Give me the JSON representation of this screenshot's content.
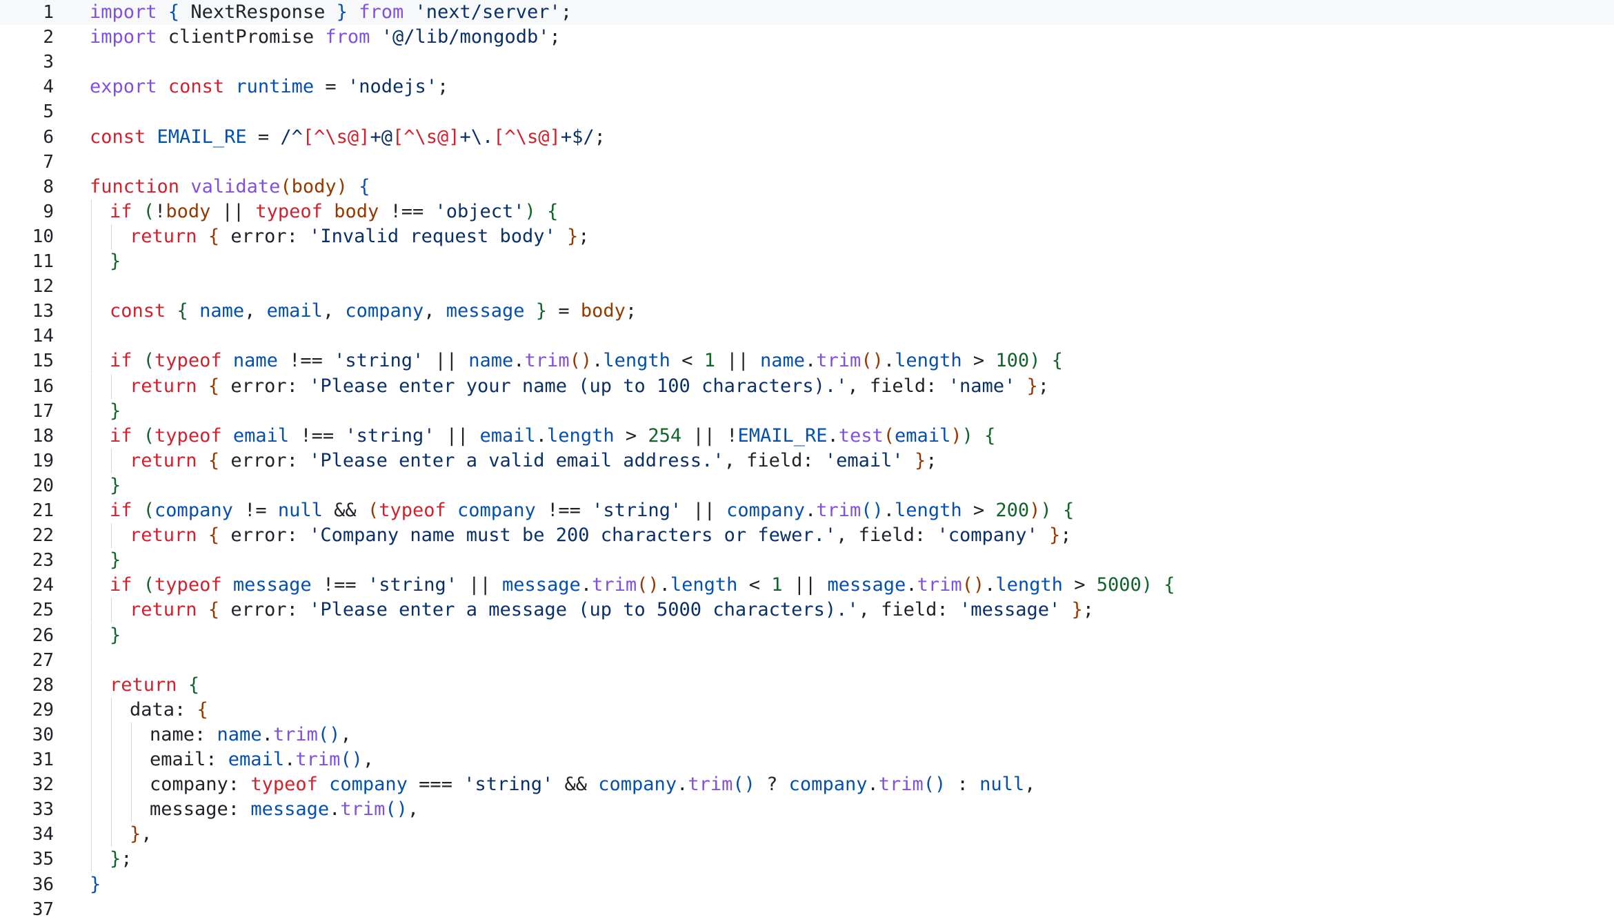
{
  "colors": {
    "keyword": "#cf222e",
    "keyword2": "#8250df",
    "fn": "#8250df",
    "ident": "#0550ae",
    "prop": "#1f2328",
    "str": "#0a3069",
    "num": "#116329",
    "regex": "#0a3069",
    "regexClass": "#cf222e",
    "brace1": "#0550ae",
    "brace2": "#116329",
    "brace3": "#953800",
    "brace0": "#1f2328",
    "plain": "#1f2328",
    "param": "#953800",
    "builtin": "#0550ae"
  },
  "lines": [
    {
      "n": "1",
      "indent": 0,
      "tokens": [
        [
          "keyword2",
          "import"
        ],
        [
          "plain",
          " "
        ],
        [
          "brace1",
          "{"
        ],
        [
          "plain",
          " NextResponse "
        ],
        [
          "brace1",
          "}"
        ],
        [
          "plain",
          " "
        ],
        [
          "keyword2",
          "from"
        ],
        [
          "plain",
          " "
        ],
        [
          "str",
          "'next/server'"
        ],
        [
          "plain",
          ";"
        ]
      ]
    },
    {
      "n": "2",
      "indent": 0,
      "tokens": [
        [
          "keyword2",
          "import"
        ],
        [
          "plain",
          " clientPromise "
        ],
        [
          "keyword2",
          "from"
        ],
        [
          "plain",
          " "
        ],
        [
          "str",
          "'@/lib/mongodb'"
        ],
        [
          "plain",
          ";"
        ]
      ]
    },
    {
      "n": "3",
      "indent": 0,
      "tokens": []
    },
    {
      "n": "4",
      "indent": 0,
      "tokens": [
        [
          "keyword2",
          "export"
        ],
        [
          "plain",
          " "
        ],
        [
          "keyword",
          "const"
        ],
        [
          "plain",
          " "
        ],
        [
          "ident",
          "runtime"
        ],
        [
          "plain",
          " = "
        ],
        [
          "str",
          "'nodejs'"
        ],
        [
          "plain",
          ";"
        ]
      ]
    },
    {
      "n": "5",
      "indent": 0,
      "tokens": []
    },
    {
      "n": "6",
      "indent": 0,
      "tokens": [
        [
          "keyword",
          "const"
        ],
        [
          "plain",
          " "
        ],
        [
          "ident",
          "EMAIL_RE"
        ],
        [
          "plain",
          " = "
        ],
        [
          "regex",
          "/^"
        ],
        [
          "regexClass",
          "[^\\s@]"
        ],
        [
          "regex",
          "+@"
        ],
        [
          "regexClass",
          "[^\\s@]"
        ],
        [
          "regex",
          "+\\."
        ],
        [
          "regexClass",
          "[^\\s@]"
        ],
        [
          "regex",
          "+$/"
        ],
        [
          "plain",
          ";"
        ]
      ]
    },
    {
      "n": "7",
      "indent": 0,
      "tokens": []
    },
    {
      "n": "8",
      "indent": 0,
      "tokens": [
        [
          "keyword",
          "function"
        ],
        [
          "plain",
          " "
        ],
        [
          "fn",
          "validate"
        ],
        [
          "brace3",
          "("
        ],
        [
          "param",
          "body"
        ],
        [
          "brace3",
          ")"
        ],
        [
          "plain",
          " "
        ],
        [
          "brace1",
          "{"
        ]
      ]
    },
    {
      "n": "9",
      "indent": 1,
      "tokens": [
        [
          "keyword",
          "if"
        ],
        [
          "plain",
          " "
        ],
        [
          "brace2",
          "("
        ],
        [
          "plain",
          "!"
        ],
        [
          "param",
          "body"
        ],
        [
          "plain",
          " || "
        ],
        [
          "keyword",
          "typeof"
        ],
        [
          "plain",
          " "
        ],
        [
          "param",
          "body"
        ],
        [
          "plain",
          " !== "
        ],
        [
          "str",
          "'object'"
        ],
        [
          "brace2",
          ")"
        ],
        [
          "plain",
          " "
        ],
        [
          "brace2",
          "{"
        ]
      ]
    },
    {
      "n": "10",
      "indent": 2,
      "tokens": [
        [
          "keyword",
          "return"
        ],
        [
          "plain",
          " "
        ],
        [
          "brace3",
          "{"
        ],
        [
          "plain",
          " error: "
        ],
        [
          "str",
          "'Invalid request body'"
        ],
        [
          "plain",
          " "
        ],
        [
          "brace3",
          "}"
        ],
        [
          "plain",
          ";"
        ]
      ]
    },
    {
      "n": "11",
      "indent": 1,
      "tokens": [
        [
          "brace2",
          "}"
        ]
      ]
    },
    {
      "n": "12",
      "indent": 1,
      "tokens": []
    },
    {
      "n": "13",
      "indent": 1,
      "tokens": [
        [
          "keyword",
          "const"
        ],
        [
          "plain",
          " "
        ],
        [
          "brace2",
          "{"
        ],
        [
          "plain",
          " "
        ],
        [
          "ident",
          "name"
        ],
        [
          "plain",
          ", "
        ],
        [
          "ident",
          "email"
        ],
        [
          "plain",
          ", "
        ],
        [
          "ident",
          "company"
        ],
        [
          "plain",
          ", "
        ],
        [
          "ident",
          "message"
        ],
        [
          "plain",
          " "
        ],
        [
          "brace2",
          "}"
        ],
        [
          "plain",
          " = "
        ],
        [
          "param",
          "body"
        ],
        [
          "plain",
          ";"
        ]
      ]
    },
    {
      "n": "14",
      "indent": 1,
      "tokens": []
    },
    {
      "n": "15",
      "indent": 1,
      "tokens": [
        [
          "keyword",
          "if"
        ],
        [
          "plain",
          " "
        ],
        [
          "brace2",
          "("
        ],
        [
          "keyword",
          "typeof"
        ],
        [
          "plain",
          " "
        ],
        [
          "ident",
          "name"
        ],
        [
          "plain",
          " !== "
        ],
        [
          "str",
          "'string'"
        ],
        [
          "plain",
          " || "
        ],
        [
          "ident",
          "name"
        ],
        [
          "plain",
          "."
        ],
        [
          "fn",
          "trim"
        ],
        [
          "brace3",
          "()"
        ],
        [
          "plain",
          "."
        ],
        [
          "builtin",
          "length"
        ],
        [
          "plain",
          " < "
        ],
        [
          "num",
          "1"
        ],
        [
          "plain",
          " || "
        ],
        [
          "ident",
          "name"
        ],
        [
          "plain",
          "."
        ],
        [
          "fn",
          "trim"
        ],
        [
          "brace3",
          "()"
        ],
        [
          "plain",
          "."
        ],
        [
          "builtin",
          "length"
        ],
        [
          "plain",
          " > "
        ],
        [
          "num",
          "100"
        ],
        [
          "brace2",
          ")"
        ],
        [
          "plain",
          " "
        ],
        [
          "brace2",
          "{"
        ]
      ]
    },
    {
      "n": "16",
      "indent": 2,
      "tokens": [
        [
          "keyword",
          "return"
        ],
        [
          "plain",
          " "
        ],
        [
          "brace3",
          "{"
        ],
        [
          "plain",
          " error: "
        ],
        [
          "str",
          "'Please enter your name (up to 100 characters).'"
        ],
        [
          "plain",
          ", field: "
        ],
        [
          "str",
          "'name'"
        ],
        [
          "plain",
          " "
        ],
        [
          "brace3",
          "}"
        ],
        [
          "plain",
          ";"
        ]
      ]
    },
    {
      "n": "17",
      "indent": 1,
      "tokens": [
        [
          "brace2",
          "}"
        ]
      ]
    },
    {
      "n": "18",
      "indent": 1,
      "tokens": [
        [
          "keyword",
          "if"
        ],
        [
          "plain",
          " "
        ],
        [
          "brace2",
          "("
        ],
        [
          "keyword",
          "typeof"
        ],
        [
          "plain",
          " "
        ],
        [
          "ident",
          "email"
        ],
        [
          "plain",
          " !== "
        ],
        [
          "str",
          "'string'"
        ],
        [
          "plain",
          " || "
        ],
        [
          "ident",
          "email"
        ],
        [
          "plain",
          "."
        ],
        [
          "builtin",
          "length"
        ],
        [
          "plain",
          " > "
        ],
        [
          "num",
          "254"
        ],
        [
          "plain",
          " || !"
        ],
        [
          "ident",
          "EMAIL_RE"
        ],
        [
          "plain",
          "."
        ],
        [
          "fn",
          "test"
        ],
        [
          "brace3",
          "("
        ],
        [
          "ident",
          "email"
        ],
        [
          "brace3",
          ")"
        ],
        [
          "brace2",
          ")"
        ],
        [
          "plain",
          " "
        ],
        [
          "brace2",
          "{"
        ]
      ]
    },
    {
      "n": "19",
      "indent": 2,
      "tokens": [
        [
          "keyword",
          "return"
        ],
        [
          "plain",
          " "
        ],
        [
          "brace3",
          "{"
        ],
        [
          "plain",
          " error: "
        ],
        [
          "str",
          "'Please enter a valid email address.'"
        ],
        [
          "plain",
          ", field: "
        ],
        [
          "str",
          "'email'"
        ],
        [
          "plain",
          " "
        ],
        [
          "brace3",
          "}"
        ],
        [
          "plain",
          ";"
        ]
      ]
    },
    {
      "n": "20",
      "indent": 1,
      "tokens": [
        [
          "brace2",
          "}"
        ]
      ]
    },
    {
      "n": "21",
      "indent": 1,
      "tokens": [
        [
          "keyword",
          "if"
        ],
        [
          "plain",
          " "
        ],
        [
          "brace2",
          "("
        ],
        [
          "ident",
          "company"
        ],
        [
          "plain",
          " != "
        ],
        [
          "builtin",
          "null"
        ],
        [
          "plain",
          " && "
        ],
        [
          "brace3",
          "("
        ],
        [
          "keyword",
          "typeof"
        ],
        [
          "plain",
          " "
        ],
        [
          "ident",
          "company"
        ],
        [
          "plain",
          " !== "
        ],
        [
          "str",
          "'string'"
        ],
        [
          "plain",
          " || "
        ],
        [
          "ident",
          "company"
        ],
        [
          "plain",
          "."
        ],
        [
          "fn",
          "trim"
        ],
        [
          "brace1",
          "()"
        ],
        [
          "plain",
          "."
        ],
        [
          "builtin",
          "length"
        ],
        [
          "plain",
          " > "
        ],
        [
          "num",
          "200"
        ],
        [
          "brace3",
          ")"
        ],
        [
          "brace2",
          ")"
        ],
        [
          "plain",
          " "
        ],
        [
          "brace2",
          "{"
        ]
      ]
    },
    {
      "n": "22",
      "indent": 2,
      "tokens": [
        [
          "keyword",
          "return"
        ],
        [
          "plain",
          " "
        ],
        [
          "brace3",
          "{"
        ],
        [
          "plain",
          " error: "
        ],
        [
          "str",
          "'Company name must be 200 characters or fewer.'"
        ],
        [
          "plain",
          ", field: "
        ],
        [
          "str",
          "'company'"
        ],
        [
          "plain",
          " "
        ],
        [
          "brace3",
          "}"
        ],
        [
          "plain",
          ";"
        ]
      ]
    },
    {
      "n": "23",
      "indent": 1,
      "tokens": [
        [
          "brace2",
          "}"
        ]
      ]
    },
    {
      "n": "24",
      "indent": 1,
      "tokens": [
        [
          "keyword",
          "if"
        ],
        [
          "plain",
          " "
        ],
        [
          "brace2",
          "("
        ],
        [
          "keyword",
          "typeof"
        ],
        [
          "plain",
          " "
        ],
        [
          "ident",
          "message"
        ],
        [
          "plain",
          " !== "
        ],
        [
          "str",
          "'string'"
        ],
        [
          "plain",
          " || "
        ],
        [
          "ident",
          "message"
        ],
        [
          "plain",
          "."
        ],
        [
          "fn",
          "trim"
        ],
        [
          "brace3",
          "()"
        ],
        [
          "plain",
          "."
        ],
        [
          "builtin",
          "length"
        ],
        [
          "plain",
          " < "
        ],
        [
          "num",
          "1"
        ],
        [
          "plain",
          " || "
        ],
        [
          "ident",
          "message"
        ],
        [
          "plain",
          "."
        ],
        [
          "fn",
          "trim"
        ],
        [
          "brace3",
          "()"
        ],
        [
          "plain",
          "."
        ],
        [
          "builtin",
          "length"
        ],
        [
          "plain",
          " > "
        ],
        [
          "num",
          "5000"
        ],
        [
          "brace2",
          ")"
        ],
        [
          "plain",
          " "
        ],
        [
          "brace2",
          "{"
        ]
      ]
    },
    {
      "n": "25",
      "indent": 2,
      "tokens": [
        [
          "keyword",
          "return"
        ],
        [
          "plain",
          " "
        ],
        [
          "brace3",
          "{"
        ],
        [
          "plain",
          " error: "
        ],
        [
          "str",
          "'Please enter a message (up to 5000 characters).'"
        ],
        [
          "plain",
          ", field: "
        ],
        [
          "str",
          "'message'"
        ],
        [
          "plain",
          " "
        ],
        [
          "brace3",
          "}"
        ],
        [
          "plain",
          ";"
        ]
      ]
    },
    {
      "n": "26",
      "indent": 1,
      "tokens": [
        [
          "brace2",
          "}"
        ]
      ]
    },
    {
      "n": "27",
      "indent": 1,
      "tokens": []
    },
    {
      "n": "28",
      "indent": 1,
      "tokens": [
        [
          "keyword",
          "return"
        ],
        [
          "plain",
          " "
        ],
        [
          "brace2",
          "{"
        ]
      ]
    },
    {
      "n": "29",
      "indent": 2,
      "tokens": [
        [
          "plain",
          "data: "
        ],
        [
          "brace3",
          "{"
        ]
      ]
    },
    {
      "n": "30",
      "indent": 3,
      "tokens": [
        [
          "plain",
          "name: "
        ],
        [
          "ident",
          "name"
        ],
        [
          "plain",
          "."
        ],
        [
          "fn",
          "trim"
        ],
        [
          "brace1",
          "()"
        ],
        [
          "plain",
          ","
        ]
      ]
    },
    {
      "n": "31",
      "indent": 3,
      "tokens": [
        [
          "plain",
          "email: "
        ],
        [
          "ident",
          "email"
        ],
        [
          "plain",
          "."
        ],
        [
          "fn",
          "trim"
        ],
        [
          "brace1",
          "()"
        ],
        [
          "plain",
          ","
        ]
      ]
    },
    {
      "n": "32",
      "indent": 3,
      "tokens": [
        [
          "plain",
          "company: "
        ],
        [
          "keyword",
          "typeof"
        ],
        [
          "plain",
          " "
        ],
        [
          "ident",
          "company"
        ],
        [
          "plain",
          " === "
        ],
        [
          "str",
          "'string'"
        ],
        [
          "plain",
          " && "
        ],
        [
          "ident",
          "company"
        ],
        [
          "plain",
          "."
        ],
        [
          "fn",
          "trim"
        ],
        [
          "brace1",
          "()"
        ],
        [
          "plain",
          " ? "
        ],
        [
          "ident",
          "company"
        ],
        [
          "plain",
          "."
        ],
        [
          "fn",
          "trim"
        ],
        [
          "brace1",
          "()"
        ],
        [
          "plain",
          " : "
        ],
        [
          "builtin",
          "null"
        ],
        [
          "plain",
          ","
        ]
      ]
    },
    {
      "n": "33",
      "indent": 3,
      "tokens": [
        [
          "plain",
          "message: "
        ],
        [
          "ident",
          "message"
        ],
        [
          "plain",
          "."
        ],
        [
          "fn",
          "trim"
        ],
        [
          "brace1",
          "()"
        ],
        [
          "plain",
          ","
        ]
      ]
    },
    {
      "n": "34",
      "indent": 2,
      "tokens": [
        [
          "brace3",
          "}"
        ],
        [
          "plain",
          ","
        ]
      ]
    },
    {
      "n": "35",
      "indent": 1,
      "tokens": [
        [
          "brace2",
          "}"
        ],
        [
          "plain",
          ";"
        ]
      ]
    },
    {
      "n": "36",
      "indent": 0,
      "tokens": [
        [
          "brace1",
          "}"
        ]
      ]
    },
    {
      "n": "37",
      "indent": 0,
      "tokens": []
    }
  ]
}
